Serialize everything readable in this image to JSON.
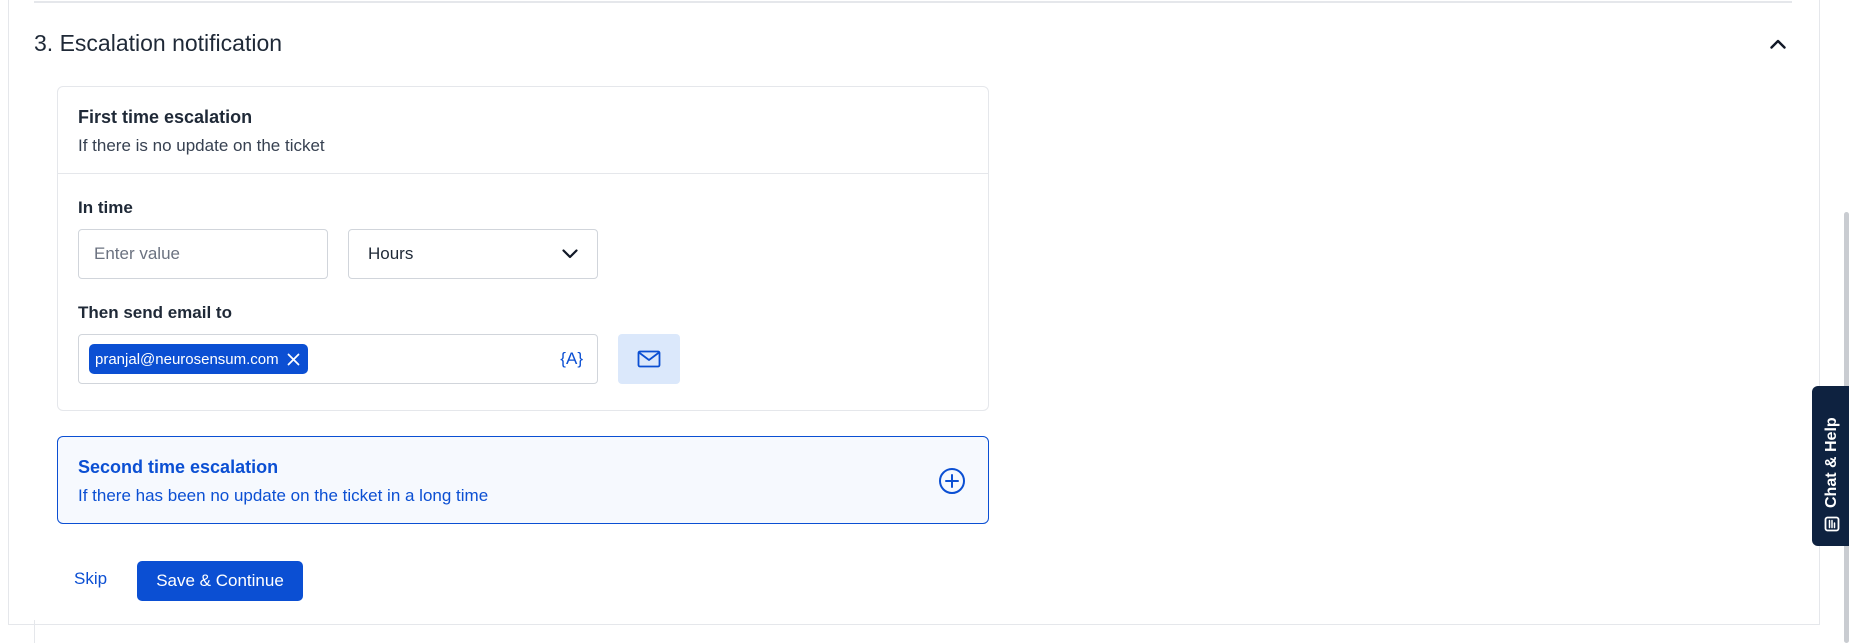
{
  "section": {
    "title": "3. Escalation notification"
  },
  "first_escalation": {
    "title": "First time escalation",
    "subtitle": "If there is no update on the ticket",
    "in_time_label": "In time",
    "value_placeholder": "Enter value",
    "unit_selected": "Hours",
    "send_label": "Then send email to",
    "recipients": [
      "pranjal@neurosensum.com"
    ],
    "variable_button": "{A}"
  },
  "second_escalation": {
    "title": "Second time escalation",
    "subtitle": "If there has been no update on the ticket in a long time"
  },
  "actions": {
    "skip_label": "Skip",
    "save_label": "Save & Continue"
  },
  "chat": {
    "label": "Chat & Help"
  },
  "colors": {
    "primary": "#0b4fd3",
    "chat_bg": "#0e2240",
    "mail_btn_bg": "#dbe8fb",
    "second_card_bg": "#f6f9fe"
  },
  "icons": {
    "collapse": "chevron-up-icon",
    "dropdown": "chevron-down-icon",
    "chip_remove": "close-icon",
    "mail": "mail-icon",
    "add": "plus-circle-icon",
    "chat": "chat-icon"
  }
}
